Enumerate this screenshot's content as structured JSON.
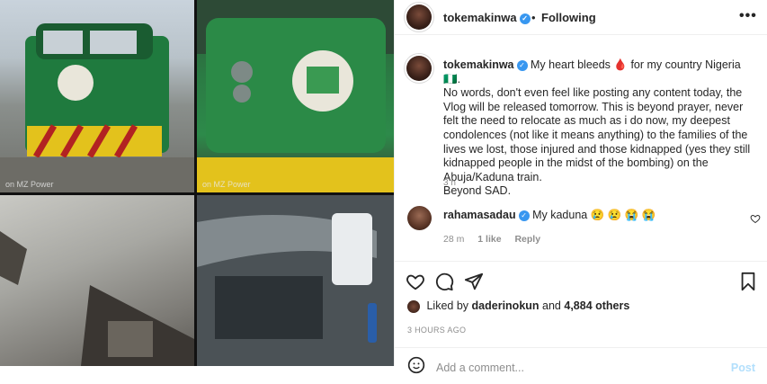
{
  "post": {
    "username": "tokemakinwa",
    "separator": "•",
    "follow_status": "Following",
    "more_label": "•••",
    "caption_line1": "My heart bleeds 🩸 for my country Nigeria 🇳🇬.",
    "caption_rest": "No words, don't even feel like posting any content today, the Vlog will be released tomorrow. This is beyond prayer, never felt the need to relocate as much as i do now, my deepest condolences (not like it means anything) to the families of the lives we lost, those injured and those kidnapped (yes they still kidnapped people in the midst of the bombing) on the Abuja/Kaduna train.",
    "caption_end": "Beyond SAD.",
    "caption_time": "3 h",
    "likes_prefix": "Liked by",
    "likes_user": "daderinokun",
    "likes_mid": "and",
    "likes_count": "4,884 others",
    "post_time": "3 HOURS AGO",
    "add_comment_placeholder": "Add a comment...",
    "post_button": "Post"
  },
  "media": {
    "watermark": "on MZ Power"
  },
  "comment": {
    "username": "rahamasadau",
    "text": "My kaduna 😢 😢 😭 😭",
    "time": "28 m",
    "likes": "1 like",
    "reply": "Reply"
  },
  "icons": {
    "heart": "heart-icon",
    "comment": "comment-icon",
    "share": "share-icon",
    "save": "bookmark-icon",
    "verified": "verified-badge-icon",
    "emoji": "emoji-icon"
  },
  "colors": {
    "verified": "#3897f0",
    "muted": "#8e8e8e",
    "text": "#262626",
    "post_disabled": "#b2dffc"
  }
}
